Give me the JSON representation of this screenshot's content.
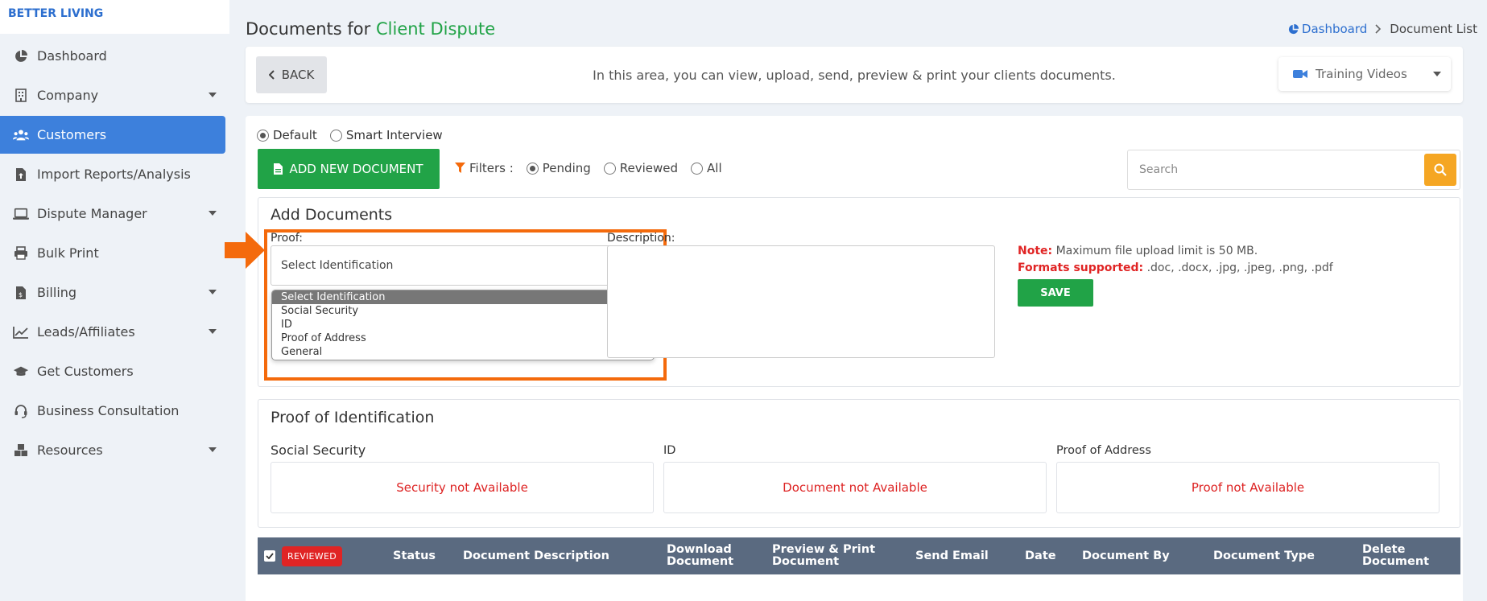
{
  "brand": "BETTER LIVING",
  "sidebar": {
    "items": [
      {
        "label": "Dashboard",
        "icon": "pie-chart-icon",
        "has_caret": false,
        "active": false
      },
      {
        "label": "Company",
        "icon": "building-icon",
        "has_caret": true,
        "active": false
      },
      {
        "label": "Customers",
        "icon": "users-icon",
        "has_caret": false,
        "active": true
      },
      {
        "label": "Import Reports/Analysis",
        "icon": "file-upload-icon",
        "has_caret": false,
        "active": false
      },
      {
        "label": "Dispute Manager",
        "icon": "laptop-icon",
        "has_caret": true,
        "active": false
      },
      {
        "label": "Bulk Print",
        "icon": "printer-icon",
        "has_caret": false,
        "active": false
      },
      {
        "label": "Billing",
        "icon": "invoice-icon",
        "has_caret": true,
        "active": false
      },
      {
        "label": "Leads/Affiliates",
        "icon": "line-chart-icon",
        "has_caret": true,
        "active": false
      },
      {
        "label": "Get Customers",
        "icon": "graduation-cap-icon",
        "has_caret": false,
        "active": false
      },
      {
        "label": "Business Consultation",
        "icon": "headset-icon",
        "has_caret": false,
        "active": false
      },
      {
        "label": "Resources",
        "icon": "boxes-icon",
        "has_caret": true,
        "active": false
      }
    ]
  },
  "header": {
    "title_prefix": "Documents for",
    "title_client": "Client Dispute",
    "breadcrumb": {
      "home": "Dashboard",
      "current": "Document List"
    }
  },
  "topbar": {
    "back_label": "BACK",
    "info": "In this area, you can view, upload, send, preview & print your clients documents.",
    "training_label": "Training Videos"
  },
  "mode": {
    "options": [
      {
        "label": "Default",
        "checked": true
      },
      {
        "label": "Smart Interview",
        "checked": false
      }
    ]
  },
  "toolbar": {
    "add_document_label": "ADD NEW DOCUMENT",
    "filters_label": "Filters :",
    "filters": [
      {
        "label": "Pending",
        "checked": true
      },
      {
        "label": "Reviewed",
        "checked": false
      },
      {
        "label": "All",
        "checked": false
      }
    ],
    "search_placeholder": "Search"
  },
  "add_documents": {
    "title": "Add Documents",
    "proof_label": "Proof:",
    "proof_selected": "Select Identification",
    "proof_options": [
      "Select Identification",
      "Social Security",
      "ID",
      "Proof of Address",
      "General"
    ],
    "description_label": "Description:",
    "note_label": "Note:",
    "note_text": "Maximum file upload limit is 50 MB.",
    "formats_label": "Formats supported:",
    "formats_text": ".doc, .docx, .jpg, .jpeg, .png, .pdf",
    "save_label": "SAVE"
  },
  "proof_identification": {
    "title": "Proof of Identification",
    "columns": [
      {
        "label": "Social Security",
        "status": "Security not Available"
      },
      {
        "label": "ID",
        "status": "Document not Available"
      },
      {
        "label": "Proof of Address",
        "status": "Proof not Available"
      }
    ]
  },
  "table": {
    "reviewed_badge": "REVIEWED",
    "headers": {
      "status": "Status",
      "description": "Document Description",
      "download_1": "Download",
      "download_2": "Document",
      "preview_1": "Preview & Print",
      "preview_2": "Document",
      "send_email": "Send Email",
      "date": "Date",
      "document_by": "Document By",
      "document_type": "Document Type",
      "delete_1": "Delete",
      "delete_2": "Document"
    }
  },
  "colors": {
    "accent_blue": "#3d80dc",
    "green": "#21a347",
    "orange_highlight": "#f46a0c",
    "search_btn": "#f5a623",
    "red_text": "#e02424",
    "table_header": "#5a6a80"
  }
}
